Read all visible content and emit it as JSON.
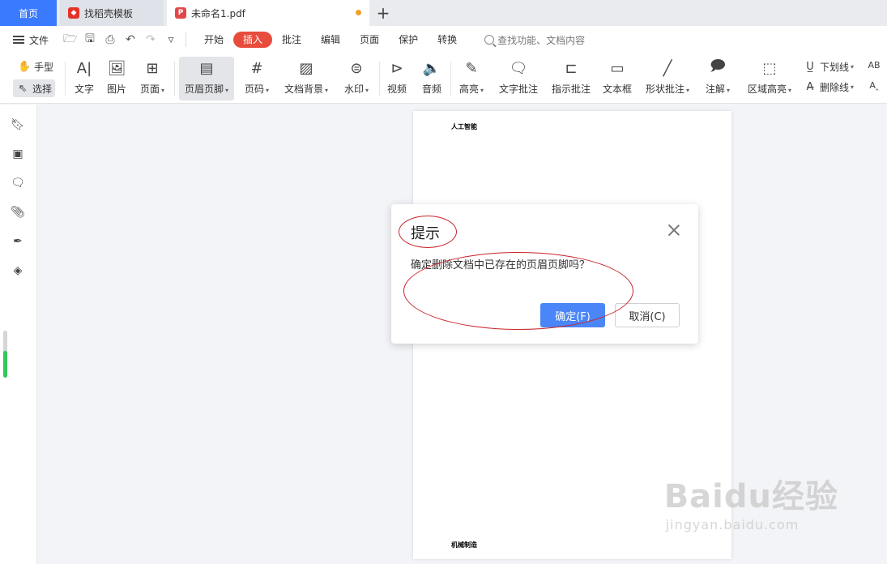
{
  "tabs": [
    {
      "label": "首页"
    },
    {
      "label": "找稻壳模板"
    },
    {
      "label": "未命名1.pdf"
    }
  ],
  "menu": {
    "file": "文件",
    "tabs": [
      "开始",
      "插入",
      "批注",
      "编辑",
      "页面",
      "保护",
      "转换"
    ],
    "active_tab": "插入",
    "search_placeholder": "查找功能、文档内容"
  },
  "ribbon": {
    "hand": "手型",
    "select": "选择",
    "items": [
      "文字",
      "图片",
      "页面",
      "页眉页脚",
      "页码",
      "文档背景",
      "水印",
      "视频",
      "音频",
      "高亮",
      "文字批注",
      "指示批注",
      "文本框",
      "形状批注",
      "注解",
      "区域高亮"
    ],
    "underline": "下划线",
    "strikethrough": "删除线"
  },
  "document": {
    "header_text": "人工智能",
    "footer_text": "机械制造"
  },
  "dialog": {
    "title": "提示",
    "message": "确定删除文档中已存在的页眉页脚吗？",
    "ok": "确定(F)",
    "cancel": "取消(C)"
  },
  "watermark": {
    "main": "Baidu经验",
    "sub": "jingyan.baidu.com"
  },
  "colors": {
    "accent": "#3a7afe",
    "active_menu": "#e74c3c",
    "annotation": "#c8232a"
  }
}
